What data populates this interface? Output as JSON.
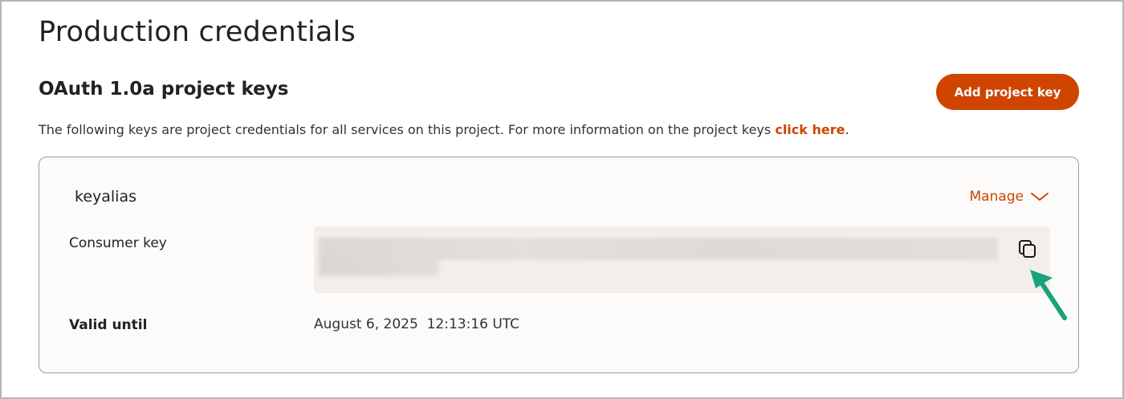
{
  "page": {
    "title": "Production credentials"
  },
  "section": {
    "title": "OAuth 1.0a project keys",
    "add_button_label": "Add project key",
    "description": "The following keys are project credentials for all services on this project. For more information on the project keys ",
    "description_link": "click here",
    "description_end": "."
  },
  "card": {
    "alias": "keyalias",
    "manage_label": "Manage",
    "manage_icon": "chevron-down-icon",
    "consumer_key_label": "Consumer key",
    "consumer_key_value": "",
    "copy_icon": "copy-icon",
    "valid_until_label": "Valid until",
    "valid_until_value": "August 6, 2025  12:13:16 UTC"
  },
  "annotation": {
    "arrow_icon": "arrow-pointer-icon",
    "arrow_color": "#1aa07a"
  },
  "colors": {
    "accent": "#cf4500"
  }
}
